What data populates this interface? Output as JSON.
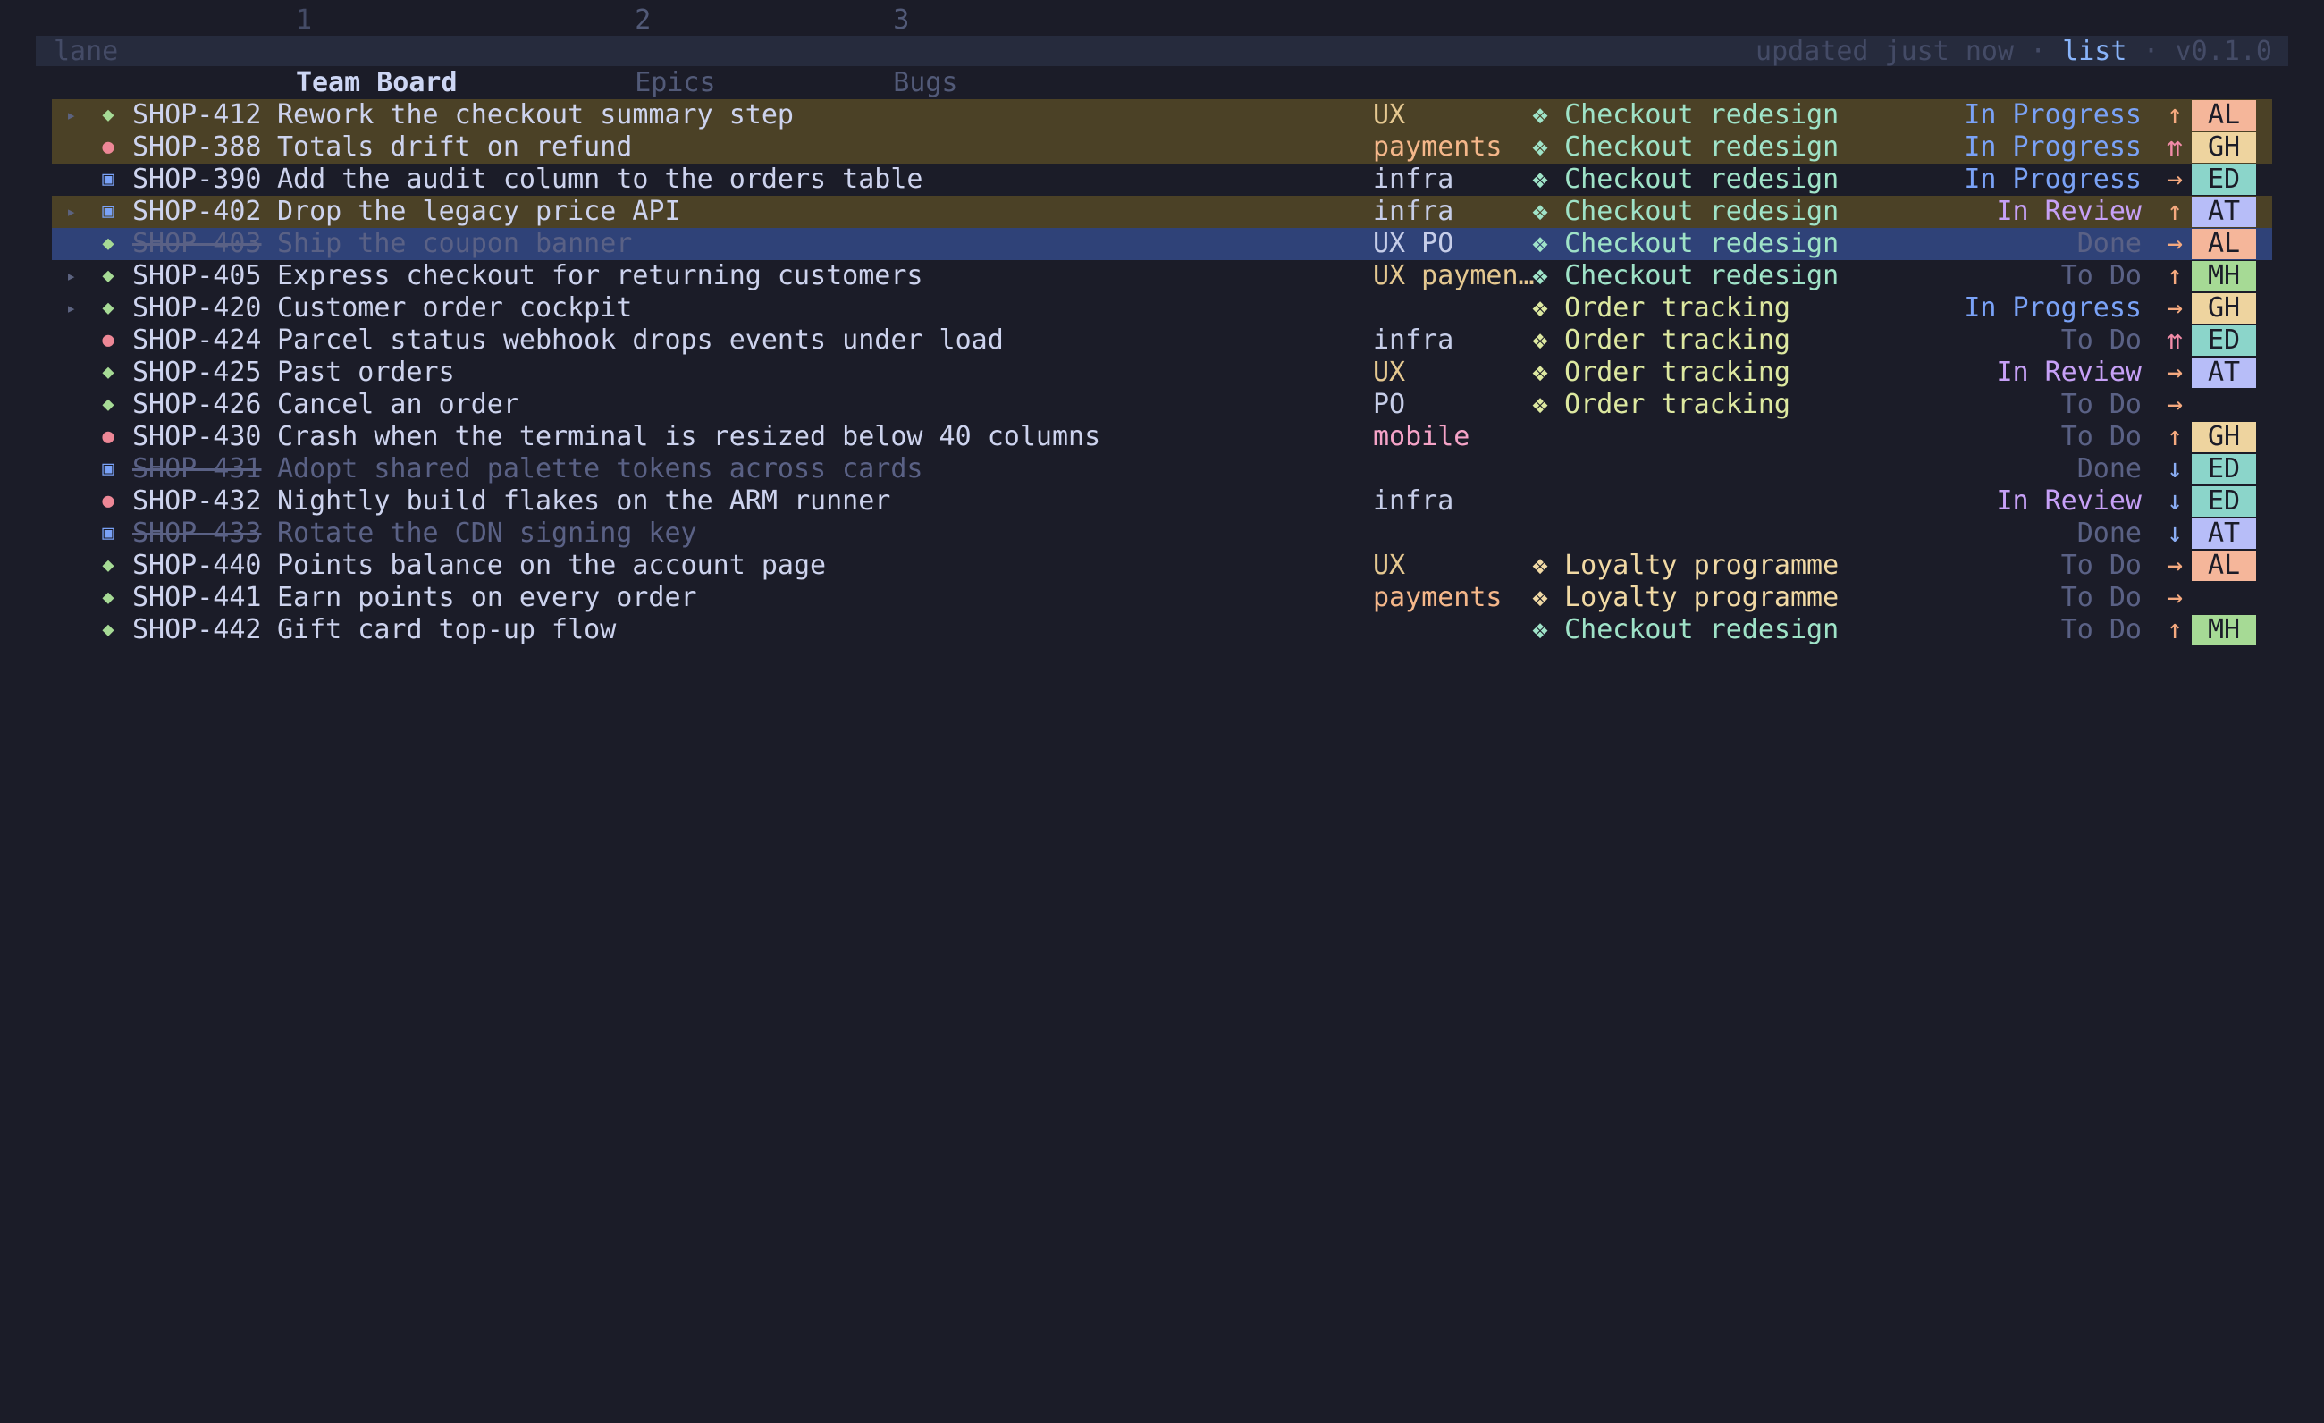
{
  "topbar": {
    "app_name": "lane",
    "tabs": [
      {
        "num": "1",
        "label": "Team Board"
      },
      {
        "num": "2",
        "label": "Epics"
      },
      {
        "num": "3",
        "label": "Bugs"
      }
    ],
    "updated": "updated just now",
    "sep1": "·",
    "mode": "list",
    "sep2": "·",
    "version": "v0.1.0"
  },
  "colors": {
    "background": "#1b1c28",
    "topbar": "#262b3d",
    "highlight_row": "#4b4126",
    "selected_row": "#2f4278",
    "avatar_AL": "#f5b69a",
    "avatar_GH": "#eed49f",
    "avatar_ED": "#8bd5ca",
    "avatar_AT": "#b7bdf8",
    "avatar_MH": "#a6da95"
  },
  "icons": {
    "expand": "▸",
    "story": "◆",
    "bug": "●",
    "task": "▣",
    "epic": "❖"
  },
  "rows": [
    {
      "expand": true,
      "type": "story",
      "key": "SHOP-412",
      "title": "Rework the checkout summary step",
      "labels": "UX",
      "label_class": "ux",
      "epic": "Checkout redesign",
      "epic_class": "checkout",
      "status": "In Progress",
      "status_class": "inprogress",
      "priority": "↑",
      "prio_class": "high",
      "assignee": "AL",
      "row_state": "hl"
    },
    {
      "expand": false,
      "type": "bug",
      "key": "SHOP-388",
      "title": "Totals drift on refund",
      "labels": "payments",
      "label_class": "payments",
      "epic": "Checkout redesign",
      "epic_class": "checkout",
      "status": "In Progress",
      "status_class": "inprogress",
      "priority": "⇈",
      "prio_class": "highest",
      "assignee": "GH",
      "row_state": "hl"
    },
    {
      "expand": false,
      "type": "task",
      "key": "SHOP-390",
      "title": "Add the audit column to the orders table",
      "labels": "infra",
      "label_class": "infra",
      "epic": "Checkout redesign",
      "epic_class": "checkout",
      "status": "In Progress",
      "status_class": "inprogress",
      "priority": "→",
      "prio_class": "medium",
      "assignee": "ED",
      "row_state": ""
    },
    {
      "expand": true,
      "type": "task",
      "key": "SHOP-402",
      "title": "Drop the legacy price API",
      "labels": "infra",
      "label_class": "infra",
      "epic": "Checkout redesign",
      "epic_class": "checkout",
      "status": "In Review",
      "status_class": "inreview",
      "priority": "↑",
      "prio_class": "high",
      "assignee": "AT",
      "row_state": "hl"
    },
    {
      "expand": false,
      "type": "story",
      "key": "SHOP-403",
      "title": "Ship the coupon banner",
      "labels": "UX PO",
      "label_class": "po",
      "epic": "Checkout redesign",
      "epic_class": "checkout",
      "status": "Done",
      "status_class": "done",
      "priority": "→",
      "prio_class": "medium",
      "assignee": "AL",
      "row_state": "sel",
      "done": true
    },
    {
      "expand": true,
      "type": "story",
      "key": "SHOP-405",
      "title": "Express checkout for returning customers",
      "labels": "UX paymen…",
      "label_class": "ux",
      "epic": "Checkout redesign",
      "epic_class": "checkout",
      "status": "To Do",
      "status_class": "todo",
      "priority": "↑",
      "prio_class": "high",
      "assignee": "MH",
      "row_state": ""
    },
    {
      "expand": true,
      "type": "story",
      "key": "SHOP-420",
      "title": "Customer order cockpit",
      "labels": "",
      "label_class": "",
      "epic": "Order tracking",
      "epic_class": "order",
      "status": "In Progress",
      "status_class": "inprogress",
      "priority": "→",
      "prio_class": "medium",
      "assignee": "GH",
      "row_state": ""
    },
    {
      "expand": false,
      "type": "bug",
      "key": "SHOP-424",
      "title": "Parcel status webhook drops events under load",
      "labels": "infra",
      "label_class": "infra",
      "epic": "Order tracking",
      "epic_class": "order",
      "status": "To Do",
      "status_class": "todo",
      "priority": "⇈",
      "prio_class": "highest",
      "assignee": "ED",
      "row_state": ""
    },
    {
      "expand": false,
      "type": "story",
      "key": "SHOP-425",
      "title": "Past orders",
      "labels": "UX",
      "label_class": "ux",
      "epic": "Order tracking",
      "epic_class": "order",
      "status": "In Review",
      "status_class": "inreview",
      "priority": "→",
      "prio_class": "medium",
      "assignee": "AT",
      "row_state": ""
    },
    {
      "expand": false,
      "type": "story",
      "key": "SHOP-426",
      "title": "Cancel an order",
      "labels": "PO",
      "label_class": "po",
      "epic": "Order tracking",
      "epic_class": "order",
      "status": "To Do",
      "status_class": "todo",
      "priority": "→",
      "prio_class": "medium",
      "assignee": "",
      "row_state": ""
    },
    {
      "expand": false,
      "type": "bug",
      "key": "SHOP-430",
      "title": "Crash when the terminal is resized below 40 columns",
      "labels": "mobile",
      "label_class": "mobile",
      "epic": "",
      "epic_class": "",
      "status": "To Do",
      "status_class": "todo",
      "priority": "↑",
      "prio_class": "high",
      "assignee": "GH",
      "row_state": ""
    },
    {
      "expand": false,
      "type": "task",
      "key": "SHOP-431",
      "title": "Adopt shared palette tokens across cards",
      "labels": "",
      "label_class": "",
      "epic": "",
      "epic_class": "",
      "status": "Done",
      "status_class": "done",
      "priority": "↓",
      "prio_class": "low",
      "assignee": "ED",
      "row_state": "",
      "done": true
    },
    {
      "expand": false,
      "type": "bug",
      "key": "SHOP-432",
      "title": "Nightly build flakes on the ARM runner",
      "labels": "infra",
      "label_class": "infra",
      "epic": "",
      "epic_class": "",
      "status": "In Review",
      "status_class": "inreview",
      "priority": "↓",
      "prio_class": "low",
      "assignee": "ED",
      "row_state": ""
    },
    {
      "expand": false,
      "type": "task",
      "key": "SHOP-433",
      "title": "Rotate the CDN signing key",
      "labels": "",
      "label_class": "",
      "epic": "",
      "epic_class": "",
      "status": "Done",
      "status_class": "done",
      "priority": "↓",
      "prio_class": "low",
      "assignee": "AT",
      "row_state": "",
      "done": true
    },
    {
      "expand": false,
      "type": "story",
      "key": "SHOP-440",
      "title": "Points balance on the account page",
      "labels": "UX",
      "label_class": "ux",
      "epic": "Loyalty programme",
      "epic_class": "loyalty",
      "status": "To Do",
      "status_class": "todo",
      "priority": "→",
      "prio_class": "medium",
      "assignee": "AL",
      "row_state": ""
    },
    {
      "expand": false,
      "type": "story",
      "key": "SHOP-441",
      "title": "Earn points on every order",
      "labels": "payments",
      "label_class": "payments",
      "epic": "Loyalty programme",
      "epic_class": "loyalty",
      "status": "To Do",
      "status_class": "todo",
      "priority": "→",
      "prio_class": "medium",
      "assignee": "",
      "row_state": ""
    },
    {
      "expand": false,
      "type": "story",
      "key": "SHOP-442",
      "title": "Gift card top-up flow",
      "labels": "",
      "label_class": "",
      "epic": "Checkout redesign",
      "epic_class": "checkout",
      "status": "To Do",
      "status_class": "todo",
      "priority": "↑",
      "prio_class": "high",
      "assignee": "MH",
      "row_state": ""
    }
  ]
}
